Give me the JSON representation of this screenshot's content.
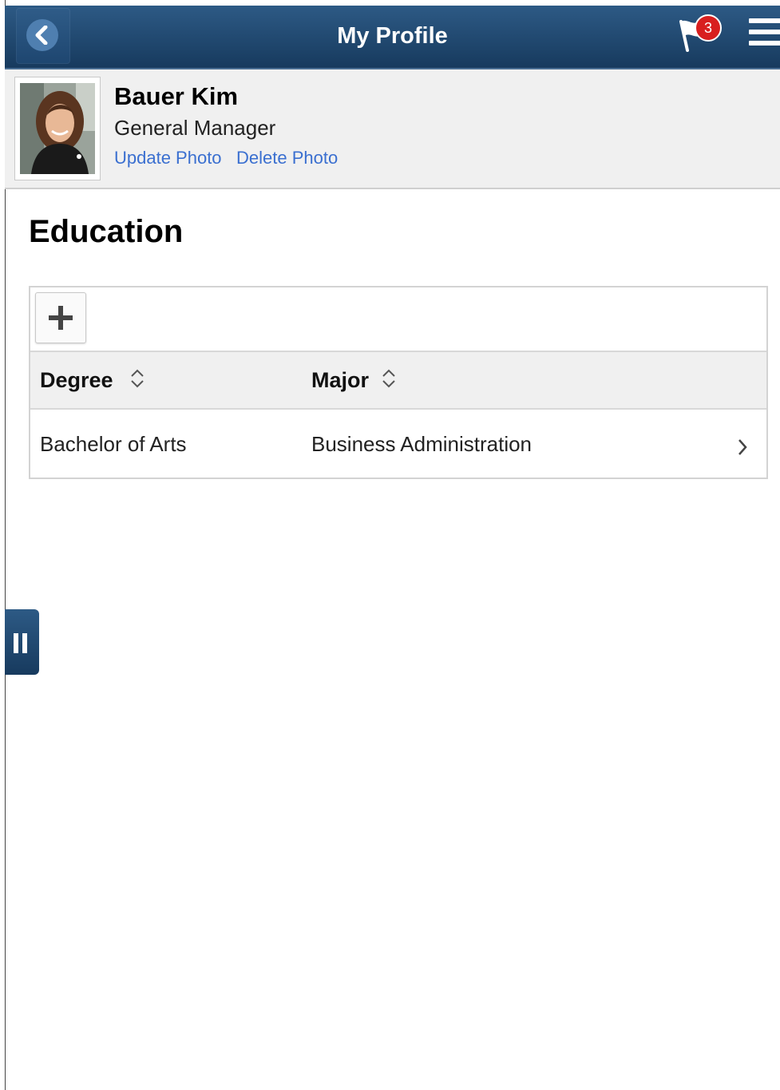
{
  "header": {
    "title": "My Profile",
    "notification_count": "3",
    "colors": {
      "bar": "#1f4a73",
      "badge": "#d81f1f"
    }
  },
  "profile": {
    "name": "Bauer Kim",
    "job_title": "General Manager",
    "update_photo": "Update Photo",
    "delete_photo": "Delete Photo",
    "link_color": "#3a6fd0"
  },
  "education": {
    "title": "Education",
    "columns": {
      "degree": "Degree",
      "major": "Major"
    },
    "rows": [
      {
        "degree": "Bachelor of Arts",
        "major": "Business Administration"
      }
    ]
  },
  "icons": [
    "back-icon",
    "flag-icon",
    "hamburger-menu-icon",
    "add-icon",
    "sort-icon",
    "chevron-right-icon",
    "side-panel-icon"
  ]
}
